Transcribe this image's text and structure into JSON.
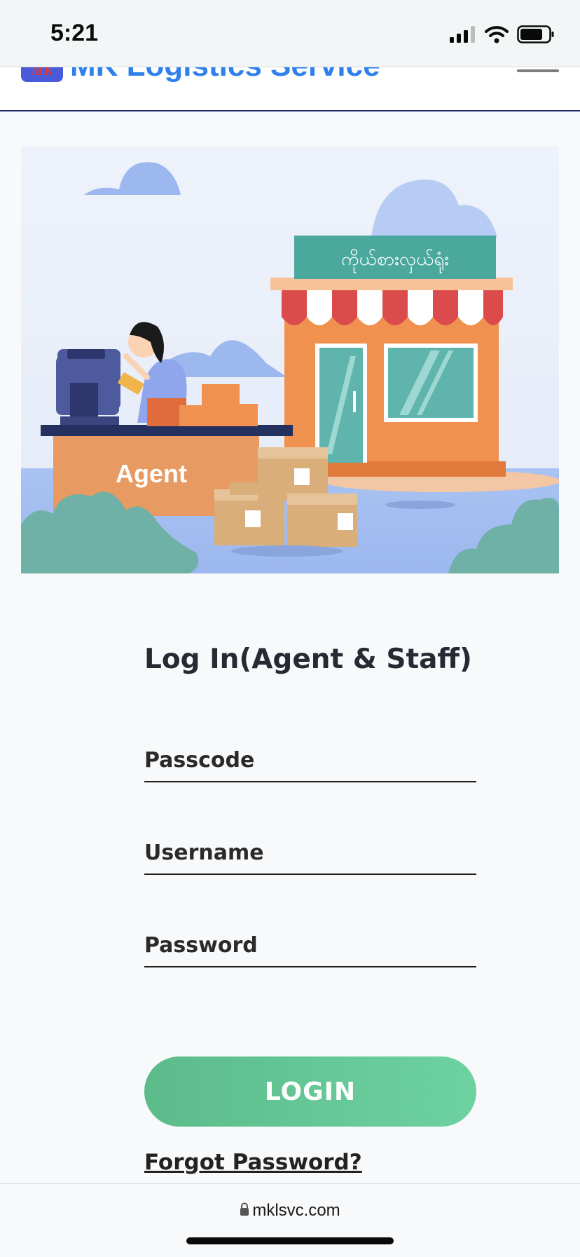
{
  "status_bar": {
    "time": "5:21"
  },
  "header": {
    "logo_text": "MK",
    "title": "MK Logistics Service"
  },
  "hero": {
    "shop_sign": "ကိုယ်စားလှယ်ရုံး",
    "counter_label": "Agent"
  },
  "login": {
    "title": "Log In(Agent & Staff)",
    "passcode_placeholder": "Passcode",
    "username_placeholder": "Username",
    "password_placeholder": "Password",
    "button_label": "LOGIN",
    "forgot_label": "Forgot Password?"
  },
  "browser": {
    "url": "mklsvc.com"
  },
  "colors": {
    "brand_blue": "#2f80ed",
    "button_green": "#5cbb8a",
    "header_border": "#1f2a6b"
  },
  "icons": [
    "signal-icon",
    "wifi-icon",
    "battery-icon",
    "menu-icon",
    "lock-icon"
  ]
}
